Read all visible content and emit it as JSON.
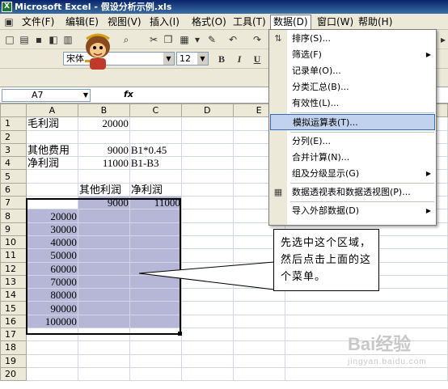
{
  "window": {
    "title": "Microsoft Excel - 假设分析示例.xls"
  },
  "menubar": {
    "items": [
      "文件(F)",
      "编辑(E)",
      "视图(V)",
      "插入(I)",
      "格式(O)",
      "工具(T)",
      "数据(D)",
      "窗口(W)",
      "帮助(H)"
    ],
    "active": "数据(D)"
  },
  "toolbar": {
    "font": "宋体",
    "size": "12",
    "bold": "B",
    "italic": "I",
    "underline": "U"
  },
  "formula_bar": {
    "cell": "A7",
    "fx": "fx",
    "value": ""
  },
  "sheet": {
    "columns": [
      "A",
      "B",
      "C",
      "D",
      "E"
    ],
    "rows": [
      {
        "n": "1",
        "a": "毛利润",
        "b": "20000",
        "c": ""
      },
      {
        "n": "2",
        "a": "",
        "b": "",
        "c": ""
      },
      {
        "n": "3",
        "a": "其他费用",
        "b": "9000",
        "c": "B1*0.45"
      },
      {
        "n": "4",
        "a": "净利润",
        "b": "11000",
        "c": "B1-B3"
      },
      {
        "n": "5",
        "a": "",
        "b": "",
        "c": ""
      },
      {
        "n": "6",
        "a": "",
        "b": "其他利润",
        "c": "净利润"
      },
      {
        "n": "7",
        "a": "",
        "b": "9000",
        "c": "11000"
      },
      {
        "n": "8",
        "a": "20000",
        "b": "",
        "c": ""
      },
      {
        "n": "9",
        "a": "30000",
        "b": "",
        "c": ""
      },
      {
        "n": "10",
        "a": "40000",
        "b": "",
        "c": ""
      },
      {
        "n": "11",
        "a": "50000",
        "b": "",
        "c": ""
      },
      {
        "n": "12",
        "a": "60000",
        "b": "",
        "c": ""
      },
      {
        "n": "13",
        "a": "70000",
        "b": "",
        "c": ""
      },
      {
        "n": "14",
        "a": "80000",
        "b": "",
        "c": ""
      },
      {
        "n": "15",
        "a": "90000",
        "b": "",
        "c": ""
      },
      {
        "n": "16",
        "a": "100000",
        "b": "",
        "c": ""
      },
      {
        "n": "17",
        "a": "",
        "b": "",
        "c": ""
      },
      {
        "n": "18",
        "a": "",
        "b": "",
        "c": ""
      },
      {
        "n": "19",
        "a": "",
        "b": "",
        "c": ""
      },
      {
        "n": "20",
        "a": "",
        "b": "",
        "c": ""
      }
    ]
  },
  "data_menu": {
    "items": [
      {
        "label": "排序(S)...",
        "sub": false
      },
      {
        "label": "筛选(F)",
        "sub": true
      },
      {
        "label": "记录单(O)...",
        "sub": false
      },
      {
        "label": "分类汇总(B)...",
        "sub": false
      },
      {
        "label": "有效性(L)...",
        "sub": false
      },
      {
        "label": "模拟运算表(T)...",
        "sub": false,
        "highlighted": true
      },
      {
        "label": "分列(E)...",
        "sub": false
      },
      {
        "label": "合并计算(N)...",
        "sub": false
      },
      {
        "label": "组及分级显示(G)",
        "sub": true
      },
      {
        "label": "数据透视表和数据透视图(P)...",
        "sub": false
      },
      {
        "label": "导入外部数据(D)",
        "sub": true
      }
    ]
  },
  "callout": {
    "text": "先选中这个区域，然后点击上面的这个菜单。"
  },
  "watermark": {
    "brand": "Bai经验",
    "url": "jingyan.baidu.com"
  },
  "colors": {
    "selection": "#b6b7d7",
    "menu_highlight": "#c1d2ee",
    "title": "#0a246a"
  }
}
